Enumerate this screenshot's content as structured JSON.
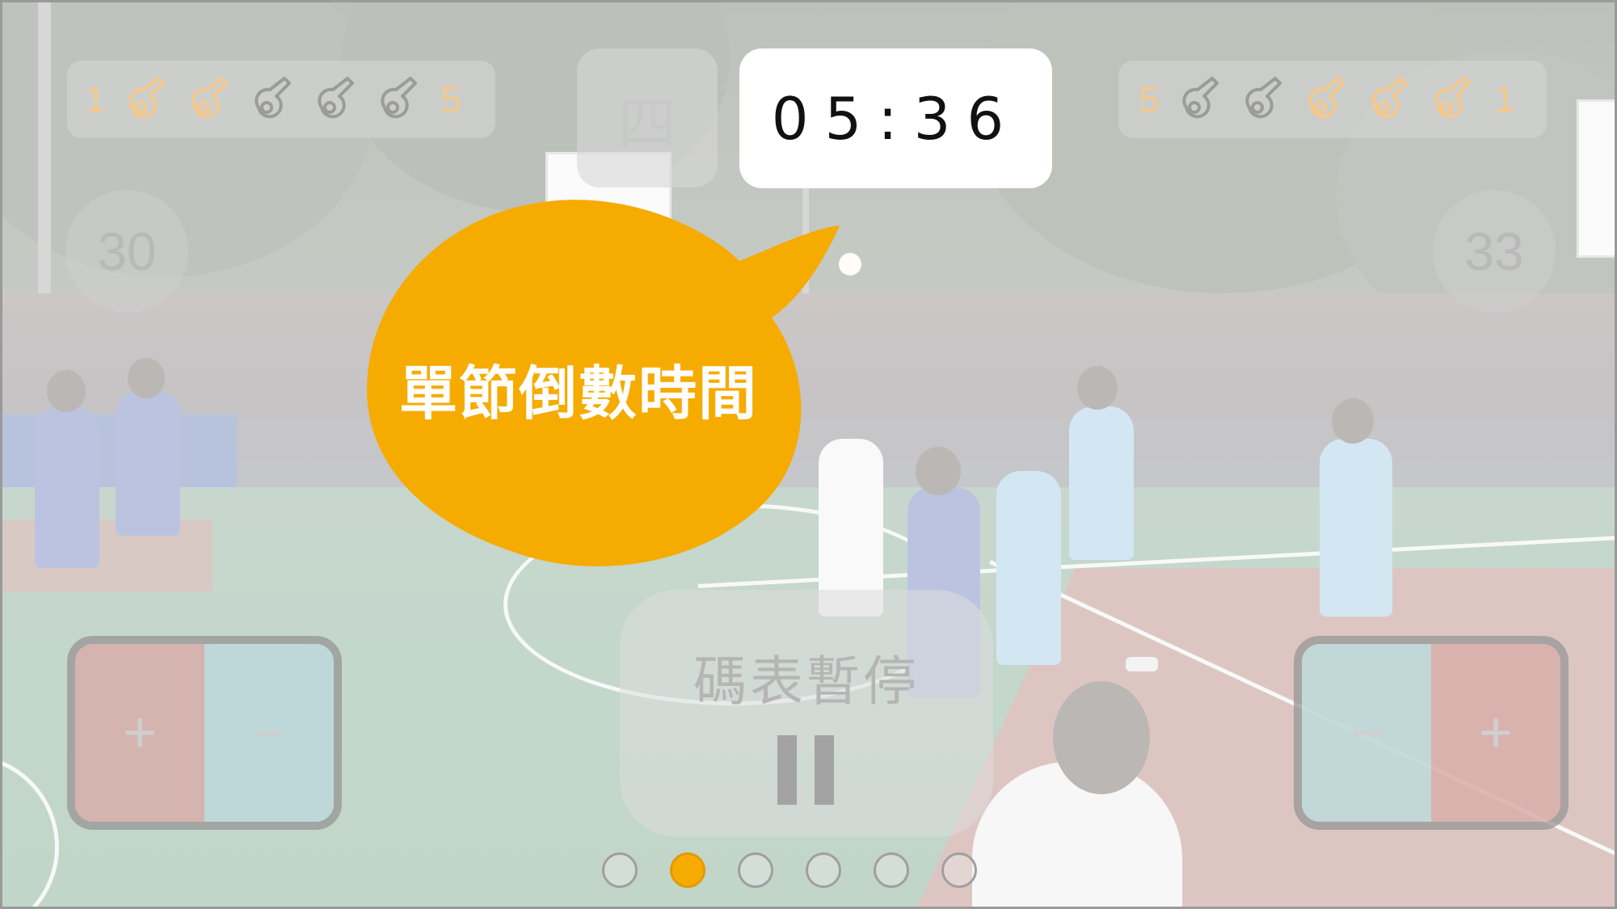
{
  "quarter": "四",
  "game_clock": "05:36",
  "home": {
    "foul_count_start": "1",
    "foul_count_end": "5",
    "fouls_used": 2,
    "score": "30",
    "timeout": {
      "plus_label": "+",
      "minus_label": "−"
    }
  },
  "away": {
    "foul_count_start": "5",
    "foul_count_end": "1",
    "fouls_used": 3,
    "score": "33",
    "timeout": {
      "plus_label": "+",
      "minus_label": "−"
    }
  },
  "pause_button": {
    "label": "碼表暫停",
    "icon": "pause-icon"
  },
  "tooltip": {
    "text": "單節倒數時間",
    "color": "#f6ab00"
  },
  "page_indicator": {
    "count": 6,
    "active_index": 1
  },
  "colors": {
    "accent": "#f6ab00",
    "foul_active": "#f5c88c",
    "foul_inactive": "#9b9b9b",
    "timeout_red": "#d8aeaa",
    "timeout_blue": "#bed8da"
  }
}
